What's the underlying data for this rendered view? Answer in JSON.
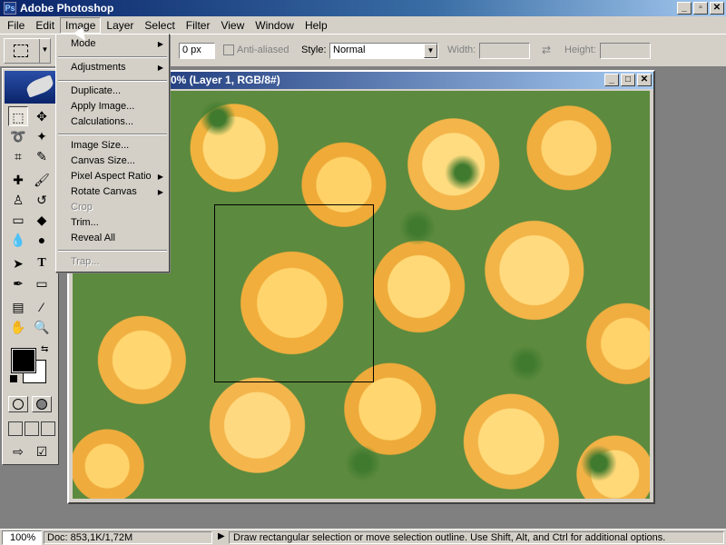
{
  "app": {
    "title": "Adobe Photoshop"
  },
  "window_controls": {
    "minimize": "_",
    "restore": "▫",
    "close": "✕"
  },
  "menubar": {
    "items": [
      "File",
      "Edit",
      "Image",
      "Layer",
      "Select",
      "Filter",
      "View",
      "Window",
      "Help"
    ],
    "active": "Image"
  },
  "options": {
    "feather_value": "0 px",
    "antialiased_label": "Anti-aliased",
    "style_label": "Style:",
    "style_value": "Normal",
    "width_label": "Width:",
    "height_label": "Height:"
  },
  "image_menu": {
    "items": [
      {
        "label": "Mode",
        "submenu": true,
        "enabled": true
      },
      {
        "label": "Adjustments",
        "submenu": true,
        "enabled": true
      },
      {
        "label": "Duplicate...",
        "submenu": false,
        "enabled": true
      },
      {
        "label": "Apply Image...",
        "submenu": false,
        "enabled": true
      },
      {
        "label": "Calculations...",
        "submenu": false,
        "enabled": true
      },
      {
        "label": "Image Size...",
        "submenu": false,
        "enabled": true
      },
      {
        "label": "Canvas Size...",
        "submenu": false,
        "enabled": true
      },
      {
        "label": "Pixel Aspect Ratio",
        "submenu": true,
        "enabled": true
      },
      {
        "label": "Rotate Canvas",
        "submenu": true,
        "enabled": true
      },
      {
        "label": "Crop",
        "submenu": false,
        "enabled": false
      },
      {
        "label": "Trim...",
        "submenu": false,
        "enabled": true
      },
      {
        "label": "Reveal All",
        "submenu": false,
        "enabled": true
      },
      {
        "label": "Trap...",
        "submenu": false,
        "enabled": false
      }
    ]
  },
  "document": {
    "title_visible": "0% (Layer 1, RGB/8#)"
  },
  "statusbar": {
    "zoom": "100%",
    "doc_size": "Doc: 853,1K/1,72M",
    "hint": "Draw rectangular selection or move selection outline.  Use Shift, Alt, and Ctrl for additional options."
  },
  "colors": {
    "foreground": "#000000",
    "background": "#ffffff",
    "titlebar": "#0a246a",
    "chrome": "#d4d0c8"
  }
}
